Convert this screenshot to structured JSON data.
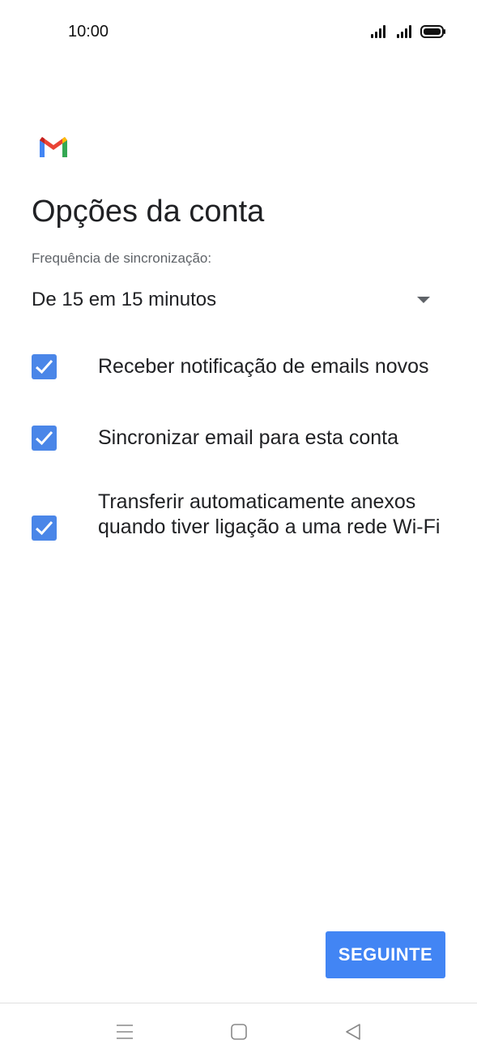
{
  "status_bar": {
    "time": "10:00",
    "icons": [
      "signal-icon",
      "signal-icon",
      "battery-icon"
    ]
  },
  "app": {
    "logo_icon": "gmail-logo-icon"
  },
  "page": {
    "title": "Opções da conta"
  },
  "sync": {
    "label": "Frequência de sincronização:",
    "selected": "De 15 em 15 minutos"
  },
  "options": [
    {
      "label": "Receber notificação de emails novos",
      "checked": true
    },
    {
      "label": "Sincronizar email para esta conta",
      "checked": true
    },
    {
      "label": "Transferir automaticamente anexos quando tiver ligação a uma rede Wi-Fi",
      "checked": true
    }
  ],
  "actions": {
    "next_label": "SEGUINTE"
  },
  "nav_bar": {
    "icons": [
      "menu-icon",
      "home-icon",
      "back-icon"
    ]
  },
  "colors": {
    "accent": "#4285f4",
    "checkbox": "#4a86e8",
    "text_primary": "#202124",
    "text_secondary": "#5f6368"
  }
}
